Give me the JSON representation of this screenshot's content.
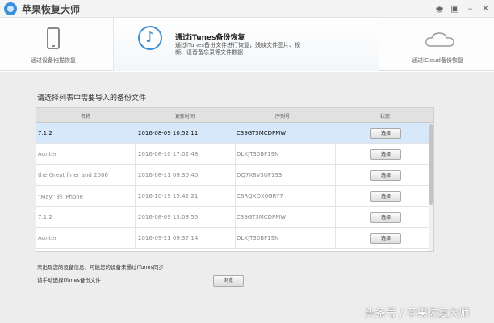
{
  "app": {
    "title": "苹果恢复大师",
    "title_icons": [
      "weibo-icon",
      "chat-icon",
      "minimize-icon",
      "close-icon"
    ]
  },
  "modes": {
    "device": {
      "label": "通过设备扫描恢复",
      "icon": "phone-icon"
    },
    "itunes": {
      "title": "通过iTunes备份恢复",
      "description": "通过iTunes备份文件进行恢复，残缺文件图片、视频、语音备忘录等文件数据",
      "icon": "music-note-icon",
      "active": true
    },
    "icloud": {
      "label": "通过iCloud备份恢复",
      "icon": "cloud-icon"
    }
  },
  "main": {
    "section_title": "请选择列表中需要导入的备份文件",
    "columns": [
      "名称",
      "更新时间",
      "序列号",
      "状态"
    ],
    "rows": [
      {
        "name": "7.1.2",
        "time": "2016-08-09 10:52:11",
        "serial": "C39GT3MCDPMW",
        "action": "选择",
        "selected": true
      },
      {
        "name": "Aunter",
        "time": "2016-08-10 17:02:48",
        "serial": "DLXJT30BF19N",
        "action": "选择",
        "selected": false
      },
      {
        "name": "the Great finer and 2006",
        "time": "2016-08-11 09:30:40",
        "serial": "DQ7X8V3UF193",
        "action": "选择",
        "selected": false
      },
      {
        "name": "\"May\" 的 iPhone",
        "time": "2016-10-19 15:42:21",
        "serial": "C6RQXDX6GRY7",
        "action": "选择",
        "selected": false
      },
      {
        "name": "7.1.2",
        "time": "2016-08-09 13:08:55",
        "serial": "C39GT3MCDPMW",
        "action": "选择",
        "selected": false
      },
      {
        "name": "Aunter",
        "time": "2016-09-21 09:37:14",
        "serial": "DLXJT30BF19N",
        "action": "选择",
        "selected": false
      }
    ],
    "note1": "未出现您的设备信息，可能您的设备未通过iTunes同步",
    "note2": "请手动选择iTunes备份文件",
    "browse_label": "浏览"
  },
  "watermark": "头条号 / 苹果恢复大师",
  "colors": {
    "accent": "#3d8fd6",
    "selected_row": "#d7e8fb",
    "background": "#ededed"
  }
}
